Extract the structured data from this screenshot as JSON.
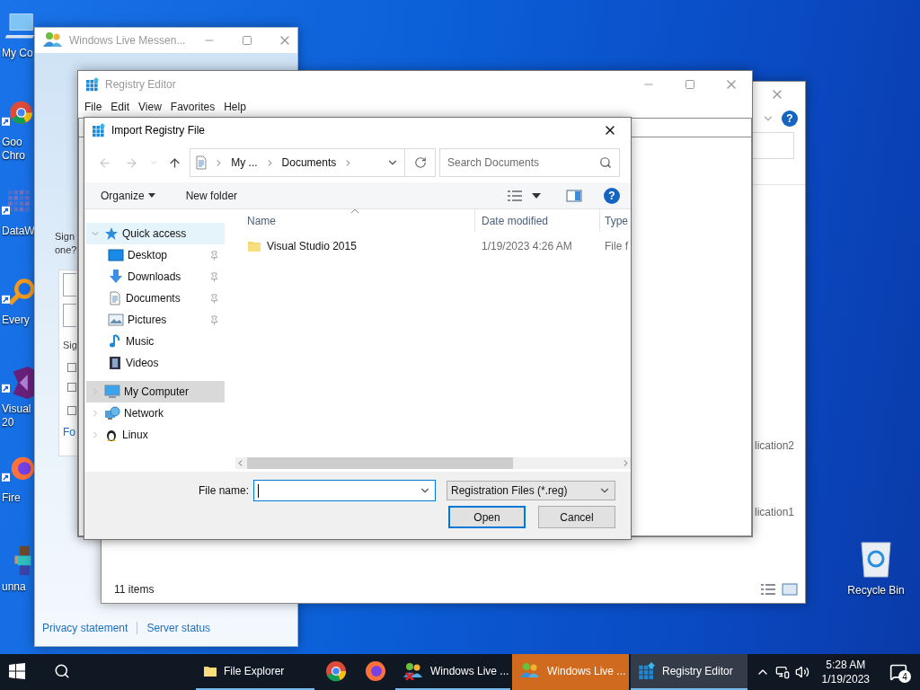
{
  "desktop_icons": [
    {
      "label": "My Co"
    },
    {
      "label": "Goo Chro"
    },
    {
      "label": "DataW"
    },
    {
      "label": "Every"
    },
    {
      "label": "Visual 20"
    },
    {
      "label": "Fire"
    },
    {
      "label": "unna"
    }
  ],
  "recycle_bin": {
    "label": "Recycle Bin"
  },
  "messenger_window": {
    "title": "Windows Live Messen...",
    "prompt": "Sign one?",
    "subtitle": "Sig",
    "checkboxes": [
      {
        "checked": false
      },
      {
        "checked": false
      },
      {
        "checked": false
      }
    ],
    "link": "Fo",
    "footer_links": [
      "Privacy statement",
      "Server status"
    ]
  },
  "explorer_window": {
    "help": "?",
    "items": [
      "lication2",
      "lication1"
    ],
    "status_bar": "11 items"
  },
  "registry_window": {
    "title": "Registry Editor",
    "menu": [
      "File",
      "Edit",
      "View",
      "Favorites",
      "Help"
    ]
  },
  "dialog": {
    "title": "Import Registry File",
    "address": [
      "My ...",
      "Documents"
    ],
    "search": {
      "placeholder": "Search Documents"
    },
    "toolbar": {
      "organize": "Organize",
      "new_folder": "New folder",
      "help": "?"
    },
    "nav": [
      {
        "label": "Quick access",
        "expanded": true,
        "hovered": true,
        "selected": false,
        "children": [
          {
            "label": "Desktop",
            "pinned": true,
            "selected": false
          },
          {
            "label": "Downloads",
            "pinned": true,
            "selected": false
          },
          {
            "label": "Documents",
            "pinned": true,
            "selected": false
          },
          {
            "label": "Pictures",
            "pinned": true,
            "selected": false
          },
          {
            "label": "Music",
            "pinned": false,
            "selected": false
          },
          {
            "label": "Videos",
            "pinned": false,
            "selected": false
          }
        ]
      },
      {
        "label": "My Computer",
        "expanded": false,
        "hovered": false,
        "selected": true
      },
      {
        "label": "Network",
        "expanded": false,
        "hovered": false,
        "selected": false
      },
      {
        "label": "Linux",
        "expanded": false,
        "hovered": false,
        "selected": false
      }
    ],
    "columns": [
      {
        "label": "Name",
        "sorted": true
      },
      {
        "label": "Date modified",
        "sorted": false
      },
      {
        "label": "Type",
        "sorted": false
      }
    ],
    "rows": [
      {
        "name": "Visual Studio 2015",
        "date": "1/19/2023 4:26 AM",
        "type": "File f",
        "selected": false
      }
    ],
    "file_name": {
      "label": "File name:"
    },
    "filter": "Registration Files (*.reg)",
    "buttons": [
      {
        "label": "Open",
        "default": true
      },
      {
        "label": "Cancel",
        "default": false
      }
    ]
  },
  "taskbar": {
    "apps": [
      {
        "label": "File Explorer",
        "running": true,
        "active": false,
        "attention": false
      },
      {
        "running": false,
        "active": false,
        "attention": false
      },
      {
        "running": false,
        "active": false,
        "attention": false
      },
      {
        "label": "Windows Live ...",
        "running": true,
        "active": false,
        "attention": false
      },
      {
        "label": "Windows Live ...",
        "running": true,
        "active": false,
        "attention": true
      },
      {
        "label": "Registry Editor",
        "running": true,
        "active": true,
        "attention": false
      }
    ],
    "time": "5:28 AM",
    "date": "1/19/2023",
    "notifications": "4"
  }
}
